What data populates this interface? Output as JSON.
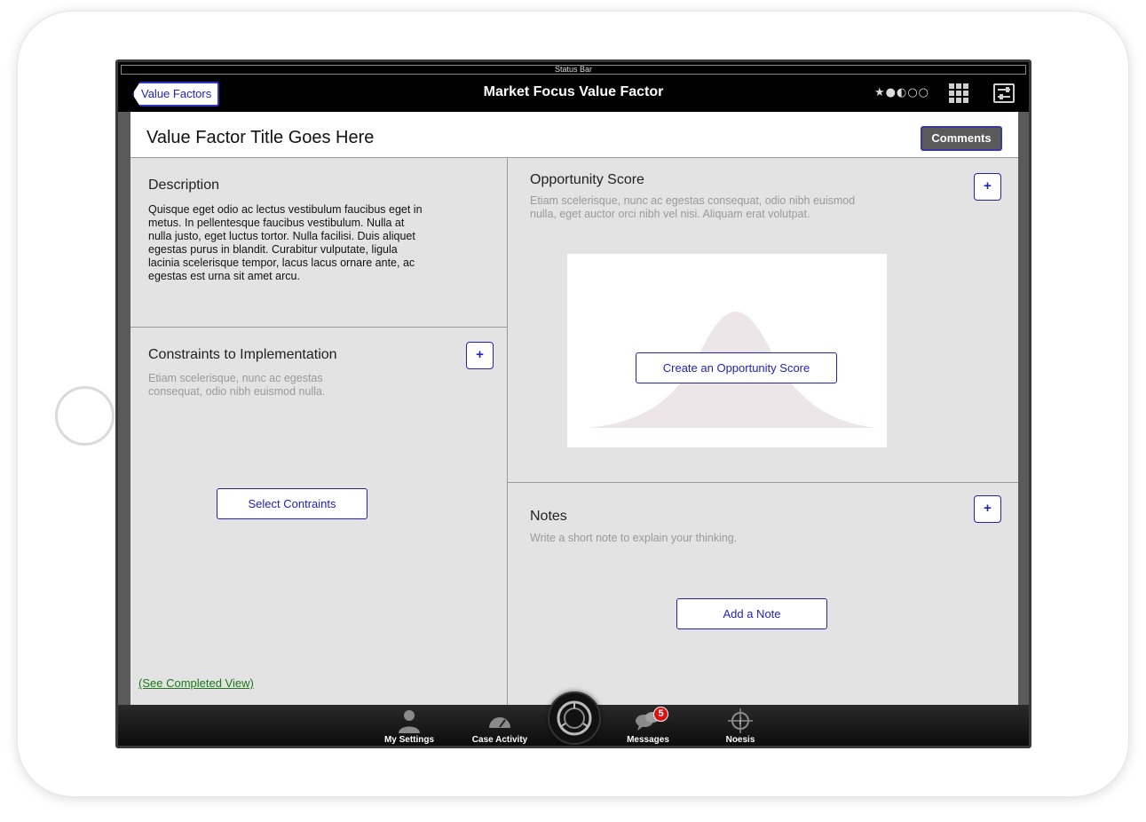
{
  "status_bar": {
    "label": "Status Bar"
  },
  "nav": {
    "back_label": "Value Factors",
    "title": "Market Focus Value Factor",
    "rating_glyphs": "★●◐○○"
  },
  "header": {
    "title": "Value Factor Title Goes Here",
    "comments_label": "Comments"
  },
  "description": {
    "heading": "Description",
    "lines": [
      "Quisque eget odio ac lectus vestibulum faucibus eget in",
      "metus. In pellentesque faucibus vestibulum. Nulla at",
      "nulla justo, eget luctus tortor. Nulla facilisi. Duis aliquet",
      "egestas purus in blandit. Curabitur vulputate, ligula",
      "lacinia scelerisque tempor, lacus lacus ornare ante, ac",
      "egestas est urna sit amet arcu."
    ]
  },
  "constraints": {
    "heading": "Constraints to Implementation",
    "hint_lines": [
      "Etiam scelerisque, nunc ac egestas",
      "consequat, odio nibh euismod nulla."
    ],
    "plus_label": "+",
    "button_label": "Select Contraints"
  },
  "opportunity": {
    "heading": "Opportunity Score",
    "hint_lines": [
      "Etiam scelerisque, nunc ac egestas consequat, odio nibh euismod",
      "nulla, eget auctor orci nibh vel nisi. Aliquam erat volutpat."
    ],
    "plus_label": "+",
    "button_label": "Create an Opportunity Score"
  },
  "notes": {
    "heading": "Notes",
    "hint": "Write a short note to explain your thinking.",
    "plus_label": "+",
    "button_label": "Add a Note"
  },
  "footer_link": "(See Completed View)",
  "tabs": [
    {
      "label": "My Settings",
      "icon": "person-icon"
    },
    {
      "label": "Case Activity",
      "icon": "gauge-icon"
    },
    {
      "label": "Messages",
      "icon": "chat-bubbles-icon",
      "badge": "5"
    },
    {
      "label": "Noesis",
      "icon": "compass-icon"
    }
  ],
  "colors": {
    "accent": "#2222bb",
    "panel_bg": "#e3e3e3",
    "link_green": "#1a7a1a",
    "badge_red": "#e01010"
  }
}
